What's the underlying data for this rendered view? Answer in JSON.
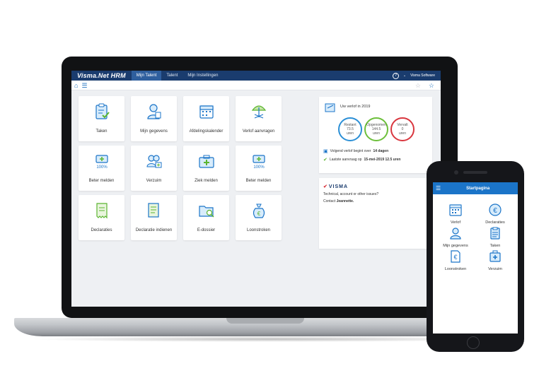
{
  "app": {
    "brand": "Visma.Net HRM",
    "tabs": [
      {
        "label": "Mijn Talent",
        "active": true
      },
      {
        "label": "Talent",
        "active": false
      },
      {
        "label": "Mijn Instellingen",
        "active": false
      }
    ],
    "help_icon": "?",
    "company": "Visma Software"
  },
  "tiles": [
    {
      "label": "Taken",
      "icon": "clipboard-check-icon"
    },
    {
      "label": "Mijn gegevens",
      "icon": "person-icon"
    },
    {
      "label": "Afdelingskalender",
      "icon": "calendar-icon"
    },
    {
      "label": "Verlof aanvragen",
      "icon": "beach-umbrella-icon"
    },
    {
      "label": "Beter melden",
      "icon": "medkit-100-icon"
    },
    {
      "label": "Verzuim",
      "icon": "people-medical-icon"
    },
    {
      "label": "Ziek melden",
      "icon": "first-aid-kit-icon"
    },
    {
      "label": "Beter melden",
      "icon": "medkit-100-icon"
    },
    {
      "label": "Declaraties",
      "icon": "receipt-icon"
    },
    {
      "label": "Declaratie indienen",
      "icon": "document-upload-icon"
    },
    {
      "label": "E-dossier",
      "icon": "folder-search-icon"
    },
    {
      "label": "Loonstroken",
      "icon": "money-bag-icon"
    }
  ],
  "verlof": {
    "title": "Uw verlof in 2019",
    "circles": [
      {
        "label": "Restant",
        "value": "73.5",
        "unit": "uren",
        "color": "#2b8fd6"
      },
      {
        "label": "Opgenomen",
        "value": "144.5",
        "unit": "uren",
        "color": "#6cbf3a"
      },
      {
        "label": "Vervalt",
        "value": "0",
        "unit": "uren",
        "color": "#d9363e"
      }
    ],
    "next_prefix": "Volgend verlof begint over",
    "next_value": "14 dagen",
    "last_prefix": "Laatste aanvraag op",
    "last_value": "15-mei-2019 12.5 uren"
  },
  "visma_card": {
    "logo": "VISMA",
    "line1": "Technical, account or other issues?",
    "line2_prefix": "Contact",
    "line2_name": "Jeannette."
  },
  "phone": {
    "title": "Startpagina",
    "tiles": [
      {
        "label": "Verlof",
        "icon": "calendar-icon"
      },
      {
        "label": "Declaraties",
        "icon": "euro-icon"
      },
      {
        "label": "Mijn gegevens",
        "icon": "person-icon"
      },
      {
        "label": "Taken",
        "icon": "clipboard-icon"
      },
      {
        "label": "Loonstroken",
        "icon": "euro-document-icon"
      },
      {
        "label": "Verzuim",
        "icon": "medkit-icon"
      }
    ]
  }
}
